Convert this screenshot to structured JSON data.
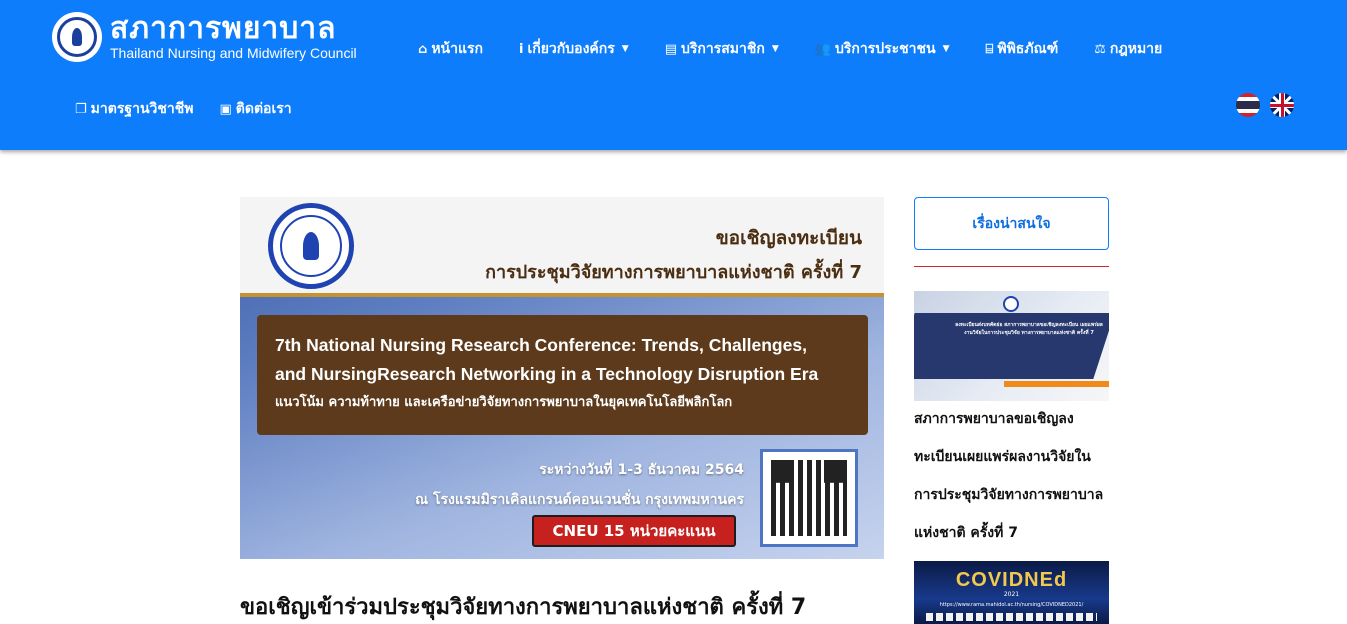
{
  "header": {
    "logo_th": "สภาการพยาบาล",
    "logo_en": "Thailand Nursing and Midwifery Council",
    "nav_row1": [
      {
        "icon": "home-icon",
        "glyph": "⌂",
        "label": "หน้าแรก",
        "dropdown": false
      },
      {
        "icon": "info-icon",
        "glyph": "i",
        "label": "เกี่ยวกับองค์กร",
        "dropdown": true
      },
      {
        "icon": "id-card-icon",
        "glyph": "▤",
        "label": "บริการสมาชิก",
        "dropdown": true
      },
      {
        "icon": "users-icon",
        "glyph": "👥",
        "label": "บริการประชาชน",
        "dropdown": true
      },
      {
        "icon": "museum-icon",
        "glyph": "⌸",
        "label": "พิพิธภัณฑ์",
        "dropdown": false
      },
      {
        "icon": "scale-icon",
        "glyph": "⚖",
        "label": "กฎหมาย",
        "dropdown": false
      }
    ],
    "nav_row2": [
      {
        "icon": "copy-icon",
        "glyph": "❐",
        "label": "มาตรฐานวิชาชีพ",
        "dropdown": false
      },
      {
        "icon": "contact-card-icon",
        "glyph": "▣",
        "label": "ติดต่อเรา",
        "dropdown": false
      }
    ],
    "languages": [
      "thai-flag-icon",
      "uk-flag-icon"
    ],
    "accent_color": "#0d7dfb"
  },
  "banner": {
    "invite": "ขอเชิญลงทะเบียน",
    "conference_th": "การประชุมวิจัยทางการพยาบาลแห่งชาติ ครั้งที่ 7",
    "title_en_line1": "7th National Nursing Research Conference: Trends, Challenges,",
    "title_en_line2": "and NursingResearch Networking in a Technology Disruption Era",
    "title_th": "แนวโน้ม ความท้าทาย และเครือข่ายวิจัยทางการพยาบาลในยุคเทคโนโลยีพลิกโลก",
    "date": "ระหว่างวันที่ 1-3 ธันวาคม 2564",
    "venue": "ณ โรงแรมมิราเคิลแกรนด์คอนเวนชั่น กรุงเทพมหานคร",
    "cneu": "CNEU 15 หน่วยคะแนน"
  },
  "article": {
    "title": "ขอเชิญเข้าร่วมประชุมวิจัยทางการพยาบาลแห่งชาติ ครั้งที่ 7"
  },
  "sidebar": {
    "button_label": "เรื่องน่าสนใจ",
    "thumb1_text": "ลงทะเบียนส่งบทคัดย่อ สภาการพยาบาลขอเชิญลงทะเบียน เผยแพร่ผลงานวิจัยในการประชุมวิจัย ทางการพยาบาลแห่งชาติ ครั้งที่ 7",
    "item1_caption": "สภาการพยาบาลขอเชิญลงทะเบียนเผยแพร่ผลงานวิจัยในการประชุมวิจัยทางการพยาบาลแห่งชาติ ครั้งที่ 7",
    "thumb2_title": "COVIDNEd",
    "thumb2_year": "2021",
    "thumb2_url": "https://www.rama.mahidol.ac.th/nursing/COVIDNED2021/"
  }
}
